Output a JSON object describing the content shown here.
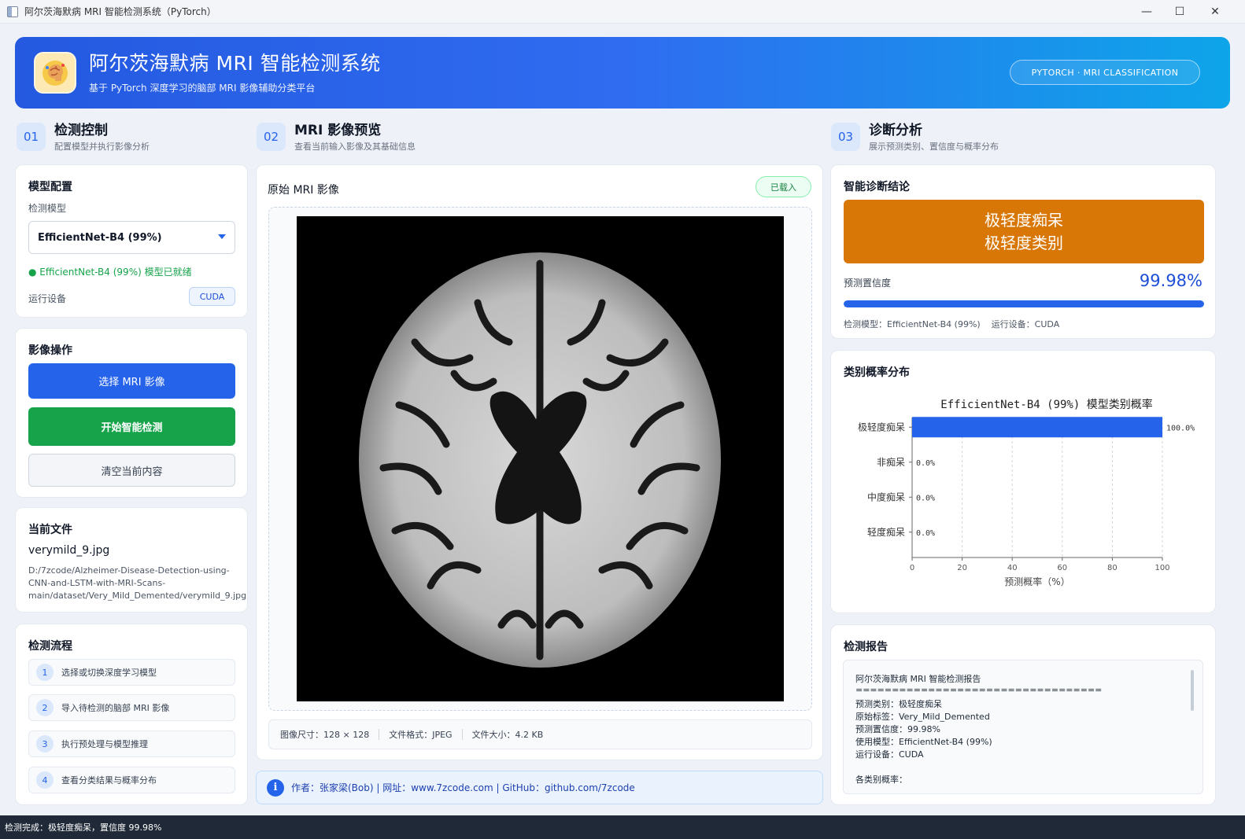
{
  "window": {
    "title": "阿尔茨海默病 MRI 智能检测系统（PyTorch）",
    "minimize": "—",
    "maximize": "☐",
    "close": "✕"
  },
  "header": {
    "title": "阿尔茨海默病 MRI 智能检测系统",
    "subtitle": "基于 PyTorch 深度学习的脑部 MRI 影像辅助分类平台",
    "badge": "PYTORCH · MRI CLASSIFICATION"
  },
  "sections": [
    {
      "num": "01",
      "title": "检测控制",
      "sub": "配置模型并执行影像分析"
    },
    {
      "num": "02",
      "title": "MRI 影像预览",
      "sub": "查看当前输入影像及其基础信息"
    },
    {
      "num": "03",
      "title": "诊断分析",
      "sub": "展示预测类别、置信度与概率分布"
    }
  ],
  "model": {
    "card_title": "模型配置",
    "label": "检测模型",
    "selected": "EfficientNet-B4 (99%)",
    "ready": "● EfficientNet-B4 (99%) 模型已就绪",
    "device_label": "运行设备",
    "device": "CUDA"
  },
  "actions": {
    "card_title": "影像操作",
    "select": "选择 MRI 影像",
    "start": "开始智能检测",
    "clear": "清空当前内容"
  },
  "file": {
    "card_title": "当前文件",
    "name": "verymild_9.jpg",
    "path": "D:/7zcode/Alzheimer-Disease-Detection-using-CNN-and-LSTM-with-MRI-Scans-main/dataset/Very_Mild_Demented/verymild_9.jpg"
  },
  "flow": {
    "card_title": "检测流程",
    "steps": [
      {
        "num": "1",
        "text": "选择或切换深度学习模型"
      },
      {
        "num": "2",
        "text": "导入待检测的脑部 MRI 影像"
      },
      {
        "num": "3",
        "text": "执行预处理与模型推理"
      },
      {
        "num": "4",
        "text": "查看分类结果与概率分布"
      }
    ]
  },
  "preview": {
    "title": "原始 MRI 影像",
    "badge": "已载入",
    "size": "图像尺寸：128 × 128",
    "format": "文件格式：JPEG",
    "filesize": "文件大小：4.2 KB"
  },
  "footer": {
    "text": "作者：张家梁(Bob) | 网址：www.7zcode.com | GitHub：github.com/7zcode"
  },
  "diagnosis": {
    "card_title": "智能诊断结论",
    "line1": "极轻度痴呆",
    "line2": "极轻度类别",
    "conf_label": "预测置信度",
    "conf_value": "99.98%",
    "conf_fraction": 0.9998,
    "meta": "检测模型：EfficientNet-B4 (99%)    运行设备：CUDA",
    "color": "#d97706"
  },
  "distribution": {
    "card_title": "类别概率分布"
  },
  "chart_data": {
    "type": "bar",
    "orientation": "horizontal",
    "title": "EfficientNet-B4 (99%) 模型类别概率",
    "categories": [
      "极轻度痴呆",
      "非痴呆",
      "中度痴呆",
      "轻度痴呆"
    ],
    "values": [
      100.0,
      0.0,
      0.0,
      0.0
    ],
    "value_labels": [
      "100.0%",
      "0.0%",
      "0.0%",
      "0.0%"
    ],
    "xlabel": "预测概率（%）",
    "xlim": [
      0,
      100
    ],
    "xticks": [
      0,
      20,
      40,
      60,
      80,
      100
    ],
    "grid": "vertical dashed",
    "bar_color": "#2563eb"
  },
  "report": {
    "card_title": "检测报告",
    "lines": [
      "阿尔茨海默病 MRI 智能检测报告",
      "==================================",
      "预测类别：极轻度痴呆",
      "原始标签：Very_Mild_Demented",
      "预测置信度：99.98%",
      "使用模型：EfficientNet-B4 (99%)",
      "运行设备：CUDA",
      "",
      "各类别概率："
    ]
  },
  "status": "检测完成：极轻度痴呆，置信度 99.98%"
}
